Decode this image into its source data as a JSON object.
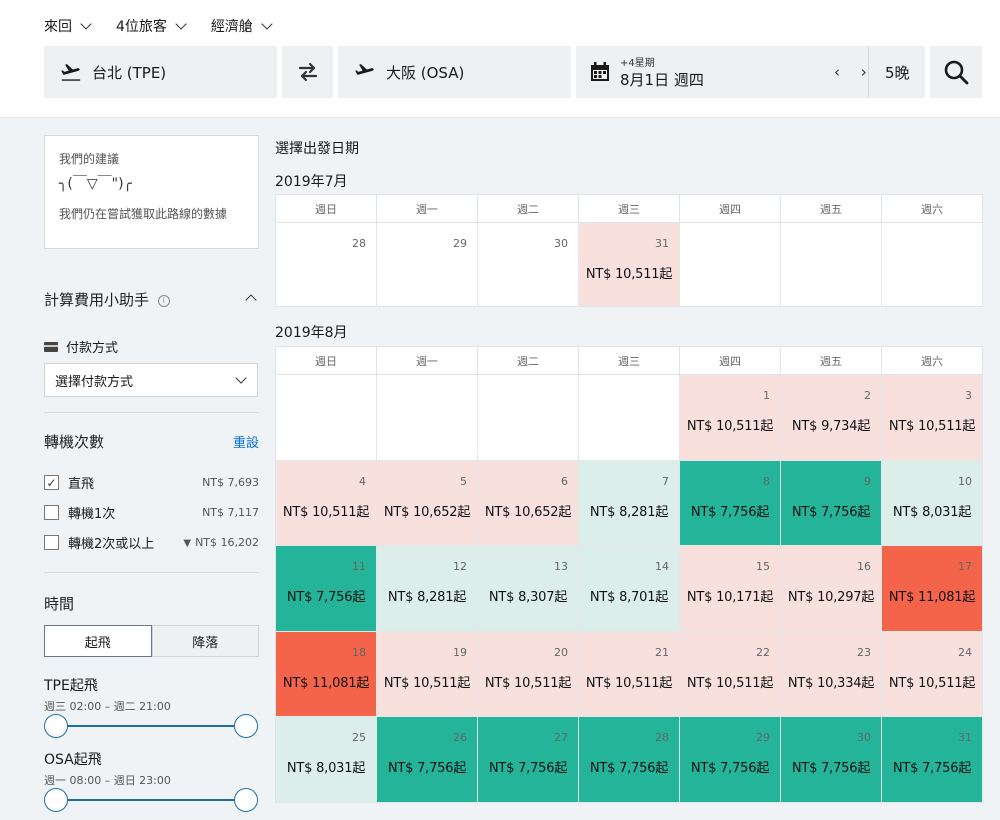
{
  "options": {
    "trip": "來回",
    "travellers": "4位旅客",
    "cabin": "經濟艙"
  },
  "search": {
    "origin": "台北 (TPE)",
    "destination": "大阪 (OSA)",
    "date_hint": "+4星期",
    "date": "8月1日 週四",
    "date_arrows": "‹ ›",
    "nights": "5晚"
  },
  "sidebar": {
    "rec_title": "我們的建議",
    "rec_face": "╮(￣▽￣\")╭",
    "rec_text": "我們仍在嘗試獲取此路線的數據",
    "calc_title": "計算費用小助手",
    "pay_label": "付款方式",
    "pay_select": "選擇付款方式",
    "stops_title": "轉機次數",
    "reset": "重設",
    "stops": [
      {
        "label": "直飛",
        "price": "NT$ 7,693",
        "checked": true
      },
      {
        "label": "轉機1次",
        "price": "NT$ 7,117",
        "checked": false
      },
      {
        "label": "轉機2次或以上",
        "price": "NT$ 16,202",
        "checked": false
      }
    ],
    "time_title": "時間",
    "tab_depart": "起飛",
    "tab_arrive": "降落",
    "tpe_label": "TPE起飛",
    "tpe_range": "週三 02:00 – 週二 21:00",
    "osa_label": "OSA起飛",
    "osa_range": "週一 08:00 – 週日 23:00"
  },
  "main": {
    "pick_title": "選擇出發日期",
    "weekdays": [
      "週日",
      "週一",
      "週二",
      "週三",
      "週四",
      "週五",
      "週六"
    ],
    "months": [
      {
        "title": "2019年7月",
        "cells": [
          {
            "day": "28",
            "price": "",
            "color": "white"
          },
          {
            "day": "29",
            "price": "",
            "color": "white"
          },
          {
            "day": "30",
            "price": "",
            "color": "white"
          },
          {
            "day": "31",
            "price": "NT$ 10,511起",
            "color": "pink"
          },
          {
            "day": "",
            "price": "",
            "color": "white"
          },
          {
            "day": "",
            "price": "",
            "color": "white"
          },
          {
            "day": "",
            "price": "",
            "color": "white"
          }
        ]
      },
      {
        "title": "2019年8月",
        "cells": [
          {
            "day": "",
            "price": "",
            "color": "white"
          },
          {
            "day": "",
            "price": "",
            "color": "white"
          },
          {
            "day": "",
            "price": "",
            "color": "white"
          },
          {
            "day": "",
            "price": "",
            "color": "white"
          },
          {
            "day": "1",
            "price": "NT$ 10,511起",
            "color": "pink"
          },
          {
            "day": "2",
            "price": "NT$ 9,734起",
            "color": "pink"
          },
          {
            "day": "3",
            "price": "NT$ 10,511起",
            "color": "pink"
          },
          {
            "day": "4",
            "price": "NT$ 10,511起",
            "color": "pink"
          },
          {
            "day": "5",
            "price": "NT$ 10,652起",
            "color": "pink"
          },
          {
            "day": "6",
            "price": "NT$ 10,652起",
            "color": "pink"
          },
          {
            "day": "7",
            "price": "NT$ 8,281起",
            "color": "mint"
          },
          {
            "day": "8",
            "price": "NT$ 7,756起",
            "color": "green"
          },
          {
            "day": "9",
            "price": "NT$ 7,756起",
            "color": "green"
          },
          {
            "day": "10",
            "price": "NT$ 8,031起",
            "color": "mint"
          },
          {
            "day": "11",
            "price": "NT$ 7,756起",
            "color": "green"
          },
          {
            "day": "12",
            "price": "NT$ 8,281起",
            "color": "mint"
          },
          {
            "day": "13",
            "price": "NT$ 8,307起",
            "color": "mint"
          },
          {
            "day": "14",
            "price": "NT$ 8,701起",
            "color": "mint"
          },
          {
            "day": "15",
            "price": "NT$ 10,171起",
            "color": "pink"
          },
          {
            "day": "16",
            "price": "NT$ 10,297起",
            "color": "pink"
          },
          {
            "day": "17",
            "price": "NT$ 11,081起",
            "color": "orange"
          },
          {
            "day": "18",
            "price": "NT$ 11,081起",
            "color": "orange"
          },
          {
            "day": "19",
            "price": "NT$ 10,511起",
            "color": "pink"
          },
          {
            "day": "20",
            "price": "NT$ 10,511起",
            "color": "pink"
          },
          {
            "day": "21",
            "price": "NT$ 10,511起",
            "color": "pink"
          },
          {
            "day": "22",
            "price": "NT$ 10,511起",
            "color": "pink"
          },
          {
            "day": "23",
            "price": "NT$ 10,334起",
            "color": "pink"
          },
          {
            "day": "24",
            "price": "NT$ 10,511起",
            "color": "pink"
          },
          {
            "day": "25",
            "price": "NT$ 8,031起",
            "color": "mint"
          },
          {
            "day": "26",
            "price": "NT$ 7,756起",
            "color": "green"
          },
          {
            "day": "27",
            "price": "NT$ 7,756起",
            "color": "green"
          },
          {
            "day": "28",
            "price": "NT$ 7,756起",
            "color": "green"
          },
          {
            "day": "29",
            "price": "NT$ 7,756起",
            "color": "green"
          },
          {
            "day": "30",
            "price": "NT$ 7,756起",
            "color": "green"
          },
          {
            "day": "31",
            "price": "NT$ 7,756起",
            "color": "green"
          }
        ]
      }
    ]
  },
  "colors": {
    "pink": "#f8e1dd",
    "mint": "#dceee9",
    "green": "#23b49a",
    "orange": "#f3644b",
    "accent": "#0770e3"
  }
}
